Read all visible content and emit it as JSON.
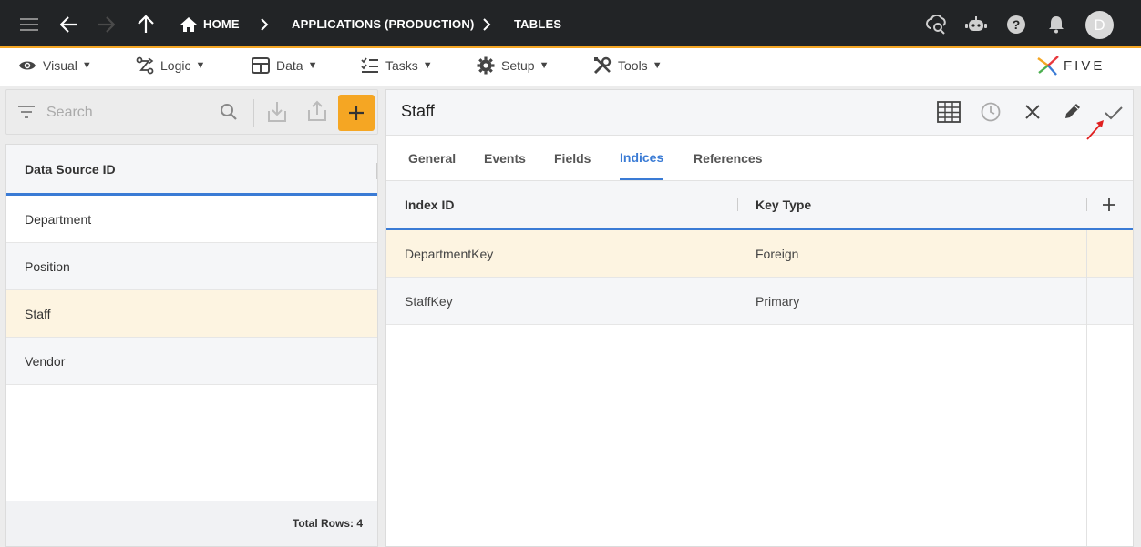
{
  "topbar": {
    "breadcrumbs": [
      "HOME",
      "APPLICATIONS (PRODUCTION)",
      "TABLES"
    ],
    "avatar_initial": "D",
    "accent": "#f5a623"
  },
  "menu": {
    "items": [
      {
        "label": "Visual",
        "icon": "eye-icon"
      },
      {
        "label": "Logic",
        "icon": "logic-icon"
      },
      {
        "label": "Data",
        "icon": "table-icon"
      },
      {
        "label": "Tasks",
        "icon": "tasks-icon"
      },
      {
        "label": "Setup",
        "icon": "gear-icon"
      },
      {
        "label": "Tools",
        "icon": "tools-icon"
      }
    ],
    "arrow": "▼",
    "logo_text": "FIVE"
  },
  "left": {
    "search_placeholder": "Search",
    "column_header": "Data Source ID",
    "rows": [
      "Department",
      "Position",
      "Staff",
      "Vendor"
    ],
    "selected_index": 2,
    "footer": "Total Rows: 4"
  },
  "right": {
    "title": "Staff",
    "tabs": [
      "General",
      "Events",
      "Fields",
      "Indices",
      "References"
    ],
    "active_tab": "Indices",
    "columns": [
      "Index ID",
      "Key Type"
    ],
    "rows": [
      {
        "index_id": "DepartmentKey",
        "key_type": "Foreign"
      },
      {
        "index_id": "StaffKey",
        "key_type": "Primary"
      }
    ]
  },
  "colors": {
    "accent": "#f5a623",
    "active_blue": "#3a7bd5",
    "selected_row": "#fdf4e1"
  }
}
